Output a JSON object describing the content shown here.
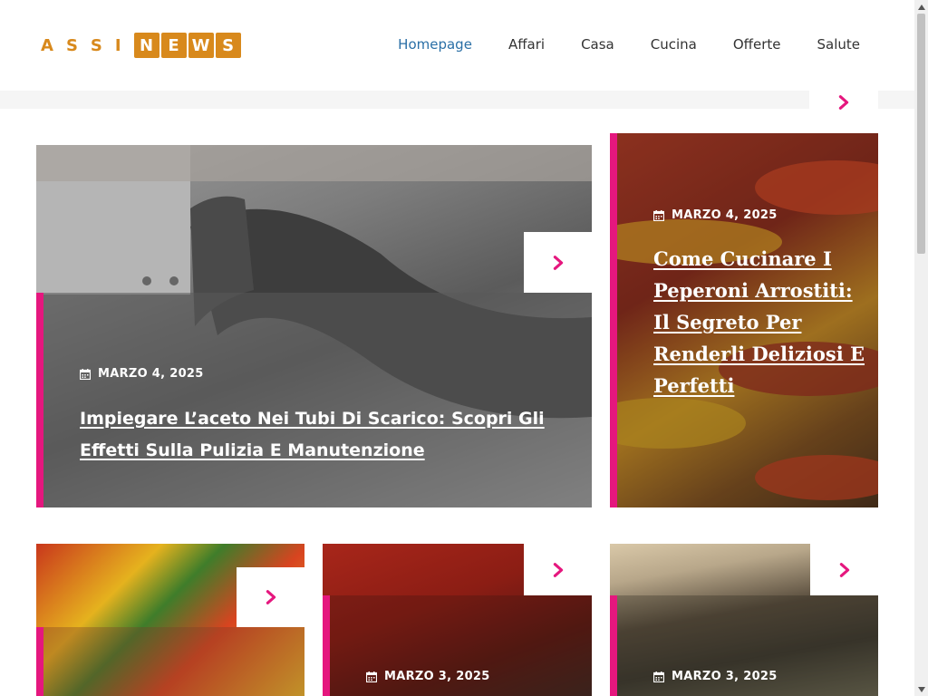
{
  "brand": {
    "letters": [
      "A",
      "S",
      "S",
      "I"
    ],
    "boxed": [
      "N",
      "E",
      "W",
      "S"
    ],
    "color": "#d8891c"
  },
  "nav": {
    "items": [
      "Homepage",
      "Affari",
      "Casa",
      "Cucina",
      "Offerte",
      "Salute"
    ],
    "active_color": "#2a6fa6"
  },
  "accent_color": "#e5177e",
  "featured": {
    "date": "MARZO 4, 2025",
    "title": "Impiegare L’aceto Nei Tubi Di Scarico: Scopri Gli Effetti Sulla Pulizia E Manutenzione"
  },
  "side": {
    "date": "MARZO 4, 2025",
    "title": "Come Cucinare I Peperoni Arrostiti: Il Segreto Per Renderli Deliziosi E Perfetti"
  },
  "row": [
    {
      "date": ""
    },
    {
      "date": "MARZO 3, 2025"
    },
    {
      "date": "MARZO 3, 2025"
    }
  ],
  "icons": {
    "arrow": "chevron-right-icon",
    "calendar": "calendar-icon"
  }
}
